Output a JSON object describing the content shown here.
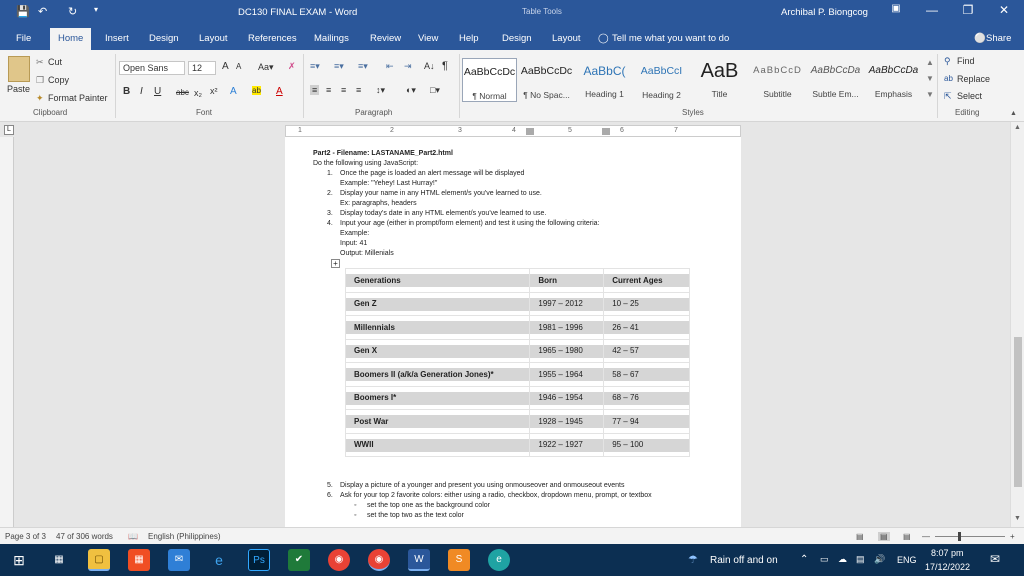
{
  "window": {
    "title": "DC130 FINAL EXAM  -  Word",
    "context_title": "Table Tools",
    "user": "Archibal P. Biongcog"
  },
  "tabs": [
    "File",
    "Home",
    "Insert",
    "Design",
    "Layout",
    "References",
    "Mailings",
    "Review",
    "View",
    "Help",
    "Design",
    "Layout"
  ],
  "tell_me": "Tell me what you want to do",
  "share": "Share",
  "clipboard": {
    "paste": "Paste",
    "cut": "Cut",
    "copy": "Copy",
    "format_painter": "Format Painter",
    "group": "Clipboard"
  },
  "font": {
    "name": "Open Sans",
    "size": "12",
    "group": "Font"
  },
  "paragraph": {
    "group": "Paragraph"
  },
  "styles": {
    "group": "Styles",
    "items": [
      {
        "preview": "AaBbCcDc",
        "name": "¶ Normal"
      },
      {
        "preview": "AaBbCcDc",
        "name": "¶ No Spac..."
      },
      {
        "preview": "AaBbC(",
        "name": "Heading 1"
      },
      {
        "preview": "AaBbCcI",
        "name": "Heading 2"
      },
      {
        "preview": "AaB",
        "name": "Title"
      },
      {
        "preview": "AaBbCcD",
        "name": "Subtitle"
      },
      {
        "preview": "AaBbCcDa",
        "name": "Subtle Em..."
      },
      {
        "preview": "AaBbCcDa",
        "name": "Emphasis"
      }
    ]
  },
  "editing": {
    "find": "Find",
    "replace": "Replace",
    "select": "Select",
    "group": "Editing"
  },
  "ruler_ticks": [
    "1",
    "2",
    "3",
    "4",
    "5",
    "6",
    "7"
  ],
  "doc": {
    "heading": "Part2 - Filename: LASTANAME_Part2.html",
    "intro": "Do the following using JavaScript:",
    "items": [
      {
        "num": "1.",
        "text": "Once the page is loaded an alert message will be displayed",
        "sub": [
          "Example: \"Yehey! Last Hurray!\""
        ]
      },
      {
        "num": "2.",
        "text": "Display your name in any HTML element/s you've learned to use.",
        "sub": [
          "Ex: paragraphs, headers"
        ]
      },
      {
        "num": "3.",
        "text": "Display today's date in any HTML element/s you've learned to use.",
        "sub": []
      },
      {
        "num": "4.",
        "text": "Input your age (either in prompt/form element) and test it using the following criteria:",
        "sub": [
          "Example:",
          "Input: 41",
          "Output: Millenials"
        ]
      }
    ],
    "after": [
      {
        "num": "5.",
        "text": "Display a picture of a younger and present you using onmouseover and onmouseout events"
      },
      {
        "num": "6.",
        "text": "Ask for your top 2 favorite colors: either using a radio, checkbox, dropdown menu, prompt, or textbox"
      }
    ],
    "bullets": [
      "set the top one as the background color",
      "set the top two as the text color"
    ]
  },
  "table": {
    "headers": [
      "Generations",
      "Born",
      "Current Ages"
    ],
    "rows": [
      [
        "Gen Z",
        "1997 – 2012",
        "10 – 25"
      ],
      [
        "Millennials",
        "1981 – 1996",
        "26 – 41"
      ],
      [
        "Gen X",
        "1965 – 1980",
        "42 – 57"
      ],
      [
        "Boomers II (a/k/a Generation Jones)*",
        "1955 – 1964",
        "58 – 67"
      ],
      [
        "Boomers I*",
        "1946 – 1954",
        "68 – 76"
      ],
      [
        "Post War",
        "1928 – 1945",
        "77 – 94"
      ],
      [
        "WWII",
        "1922 – 1927",
        "95 – 100"
      ]
    ]
  },
  "status": {
    "page": "Page 3 of 3",
    "words": "47 of 306 words",
    "language": "English (Philippines)"
  },
  "taskbar": {
    "weather": "Rain off and on",
    "lang": "ENG",
    "time": "8:07 pm",
    "date": "17/12/2022"
  }
}
